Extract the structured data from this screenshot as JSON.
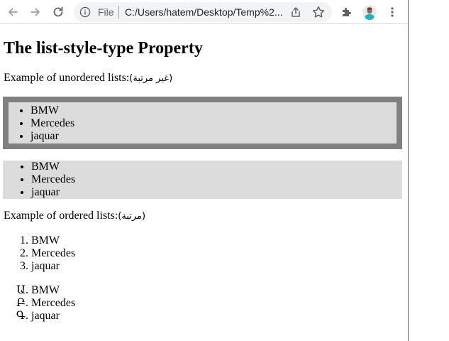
{
  "browser": {
    "file_label": "File",
    "url": "C:/Users/hatem/Desktop/Temp%2...",
    "icons": [
      "back-arrow-icon",
      "forward-arrow-icon",
      "reload-icon",
      "info-icon",
      "share-icon",
      "star-icon",
      "extensions-puzzle-icon",
      "profile-avatar",
      "kebab-menu-icon"
    ]
  },
  "page": {
    "heading": "The list-style-type Property",
    "unordered_intro": "Example of unordered lists:",
    "unordered_intro_arabic": "(غير مرتبة)",
    "unordered_list_1": [
      "BMW",
      "Mercedes",
      "jaquar"
    ],
    "unordered_list_2": [
      "BMW",
      "Mercedes",
      "jaquar"
    ],
    "ordered_intro": "Example of ordered lists:",
    "ordered_intro_arabic": "(مرتبة)",
    "ordered_list_1": [
      "BMW",
      "Mercedes",
      "jaquar"
    ],
    "ordered_list_2": [
      "BMW",
      "Mercedes",
      "jaquar"
    ]
  },
  "colors": {
    "list_background": "#dcdcdc",
    "list_border": "#808080"
  }
}
